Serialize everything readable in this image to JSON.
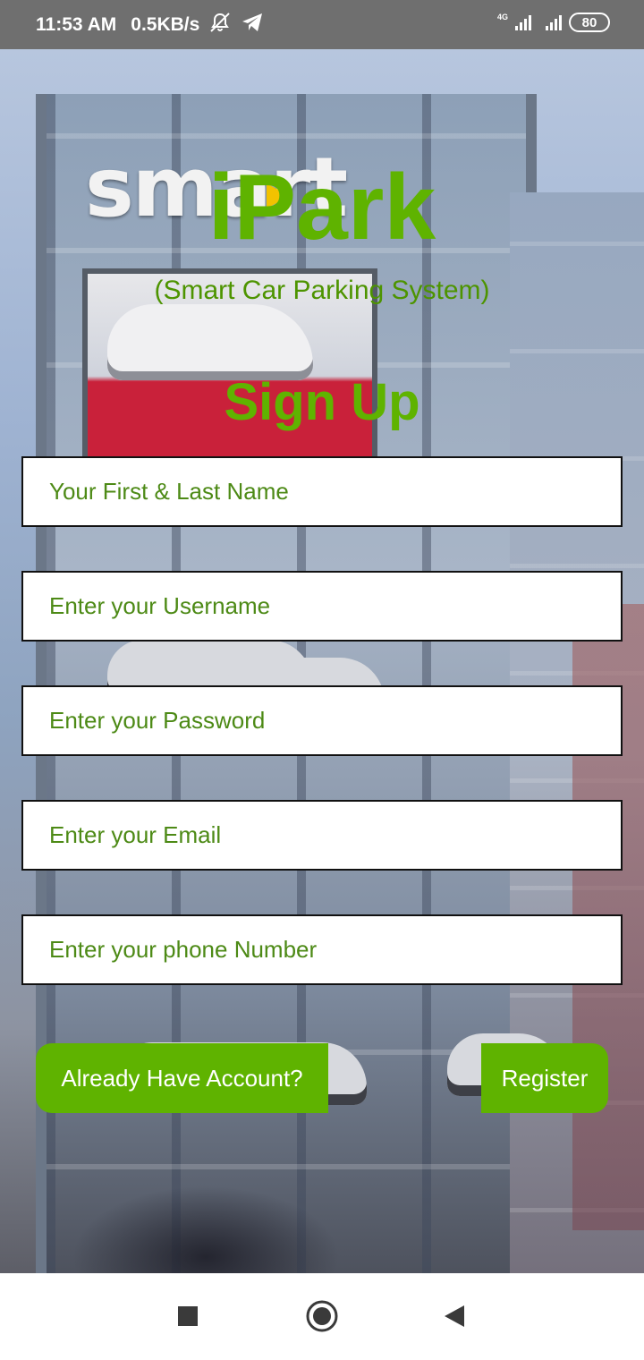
{
  "status_bar": {
    "time": "11:53 AM",
    "speed": "0.5KB/s",
    "network_label": "4G",
    "battery": "80"
  },
  "background": {
    "sign_text": "smart"
  },
  "app": {
    "title": "iPark",
    "subtitle": "(Smart Car Parking System)"
  },
  "form": {
    "title": "Sign Up",
    "fields": [
      {
        "placeholder": "Your First & Last Name",
        "value": ""
      },
      {
        "placeholder": "Enter your Username",
        "value": ""
      },
      {
        "placeholder": "Enter your Password",
        "value": ""
      },
      {
        "placeholder": "Enter your Email",
        "value": ""
      },
      {
        "placeholder": "Enter your phone Number",
        "value": ""
      }
    ],
    "login_button": "Already Have Account?",
    "register_button": "Register"
  },
  "colors": {
    "brand_green": "#5fb300",
    "status_bar": "#6f6f6f"
  },
  "icons": [
    "mute-icon",
    "telegram-icon",
    "signal-icon",
    "battery-icon",
    "recents-icon",
    "home-icon",
    "back-icon"
  ]
}
